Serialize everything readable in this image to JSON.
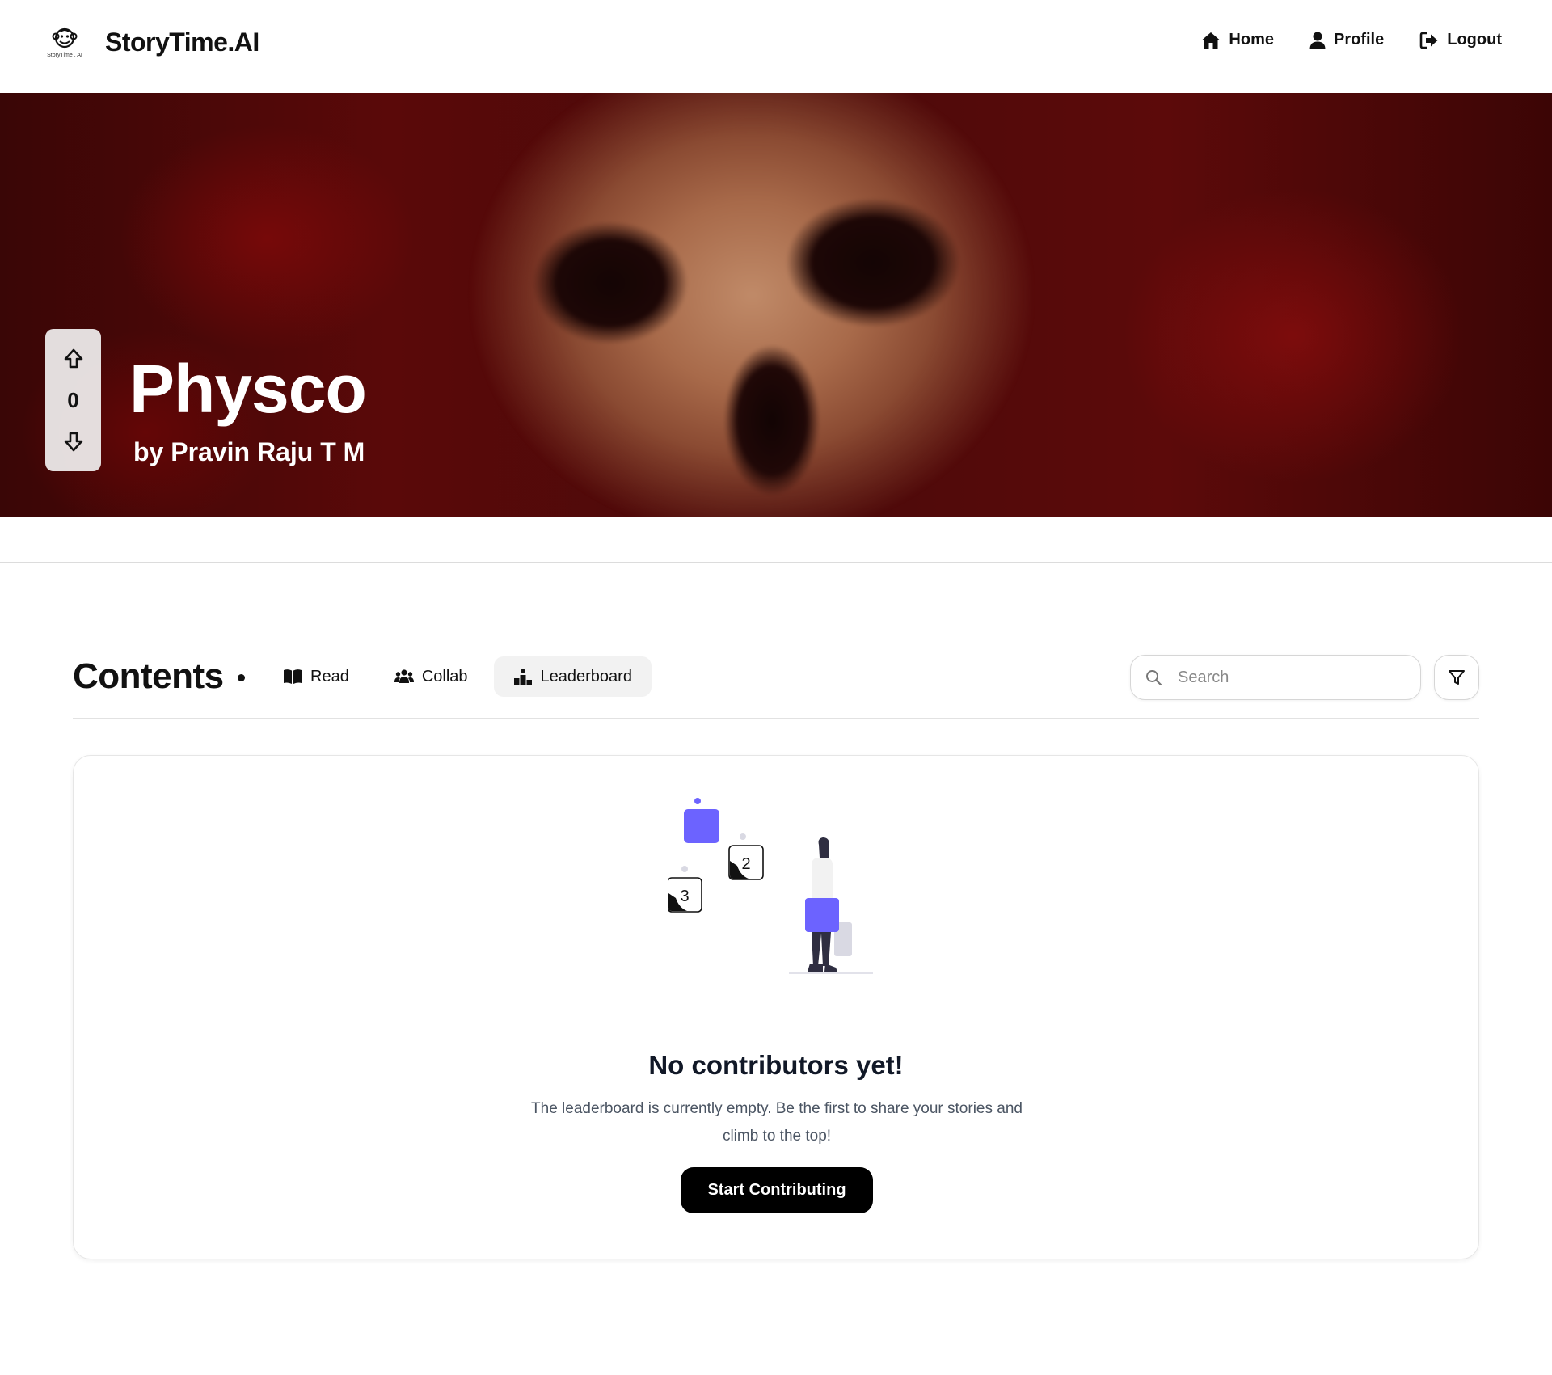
{
  "header": {
    "logo_text": "StoryTime . AI",
    "brand_name": "StoryTime.AI",
    "nav": [
      {
        "label": "Home",
        "icon": "home-icon"
      },
      {
        "label": "Profile",
        "icon": "user-icon"
      },
      {
        "label": "Logout",
        "icon": "logout-icon"
      }
    ]
  },
  "hero": {
    "title": "Physco",
    "author": "by Pravin Raju T M",
    "votes": "0"
  },
  "contents": {
    "title": "Contents",
    "tabs": [
      {
        "label": "Read",
        "icon": "book-icon",
        "active": false
      },
      {
        "label": "Collab",
        "icon": "users-icon",
        "active": false
      },
      {
        "label": "Leaderboard",
        "icon": "podium-icon",
        "active": true
      }
    ],
    "search_placeholder": "Search"
  },
  "empty_state": {
    "title": "No contributors yet!",
    "description": "The leaderboard is currently empty. Be the first to share your stories and climb to the top!",
    "button_label": "Start Contributing",
    "rank_labels": [
      "2",
      "3"
    ]
  },
  "colors": {
    "accent": "#6c63ff",
    "button": "#000000",
    "hero_red": "#5a0909"
  }
}
